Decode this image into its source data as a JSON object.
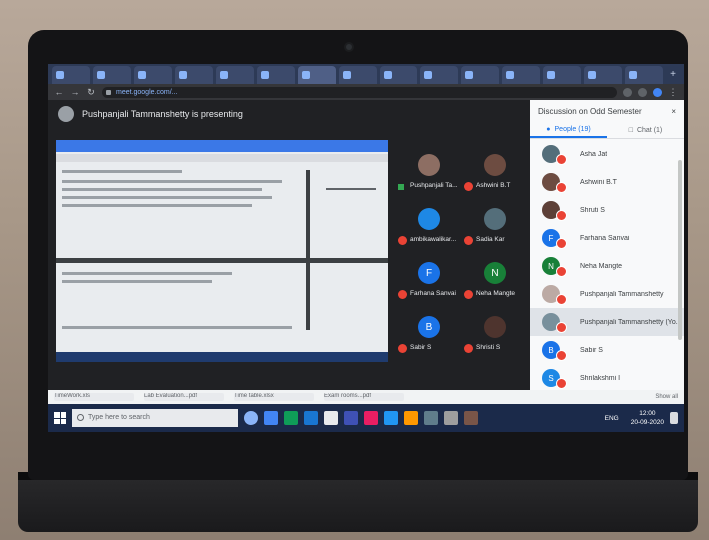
{
  "browser": {
    "tabs": [
      "",
      "",
      "",
      "",
      "",
      "",
      "",
      "",
      "",
      "",
      "",
      "",
      "",
      "",
      ""
    ],
    "new_tab": "+",
    "url": "meet.google.com/..."
  },
  "meet": {
    "presenting_text": "Pushpanjali Tammanshetty is presenting",
    "tiles": [
      {
        "name": "Pushpanjali Ta...",
        "initial": "",
        "color": "#8d6e63",
        "mic": "green"
      },
      {
        "name": "Ashwini B.T",
        "initial": "",
        "color": "#6d4c41",
        "mic": "red"
      },
      {
        "name": "ambikawalikar...",
        "initial": "",
        "color": "#1e88e5",
        "mic": "red"
      },
      {
        "name": "Sadia Kar",
        "initial": "",
        "color": "#546e7a",
        "mic": "red"
      },
      {
        "name": "Farhana Sanvai",
        "initial": "F",
        "color": "#1a73e8",
        "mic": "red"
      },
      {
        "name": "Neha Mangte",
        "initial": "N",
        "color": "#188038",
        "mic": "red"
      },
      {
        "name": "Sabir S",
        "initial": "B",
        "color": "#1a73e8",
        "mic": "red"
      },
      {
        "name": "Shristi S",
        "initial": "",
        "color": "#4e342e",
        "mic": "red"
      }
    ]
  },
  "side": {
    "title": "Discussion on Odd Semester",
    "close": "×",
    "tab_people": "People (19)",
    "tab_chat": "Chat (1)",
    "people": [
      {
        "name": "Asha Jat",
        "initial": "",
        "color": "#546e7a"
      },
      {
        "name": "Ashwini B.T",
        "initial": "",
        "color": "#6d4c41"
      },
      {
        "name": "Shruti S",
        "initial": "",
        "color": "#5d4037"
      },
      {
        "name": "Farhana Sanvai",
        "initial": "F",
        "color": "#1a73e8"
      },
      {
        "name": "Neha Mangte",
        "initial": "N",
        "color": "#188038"
      },
      {
        "name": "Pushpanjali Tammanshetty",
        "initial": "",
        "color": "#bcaaa4"
      },
      {
        "name": "Pushpanjali Tammanshetty (Yo...",
        "initial": "",
        "color": "#78909c"
      },
      {
        "name": "Sabir S",
        "initial": "B",
        "color": "#1a73e8"
      },
      {
        "name": "Shrilakshmi I",
        "initial": "S",
        "color": "#1e88e5"
      }
    ]
  },
  "downloads": [
    "TimeWork.xls",
    "Lab Evaluation...pdf",
    "Time table.xlsx",
    "Exam rooms...pdf",
    "Show all"
  ],
  "taskbar": {
    "search_placeholder": "Type here to search",
    "lang": "ENG",
    "time": "12:00",
    "date": "20-09-2020"
  },
  "colors": {
    "accent": "#1a73e8",
    "mic_off": "#ea4335",
    "taskbar": "#1b2a4a"
  }
}
